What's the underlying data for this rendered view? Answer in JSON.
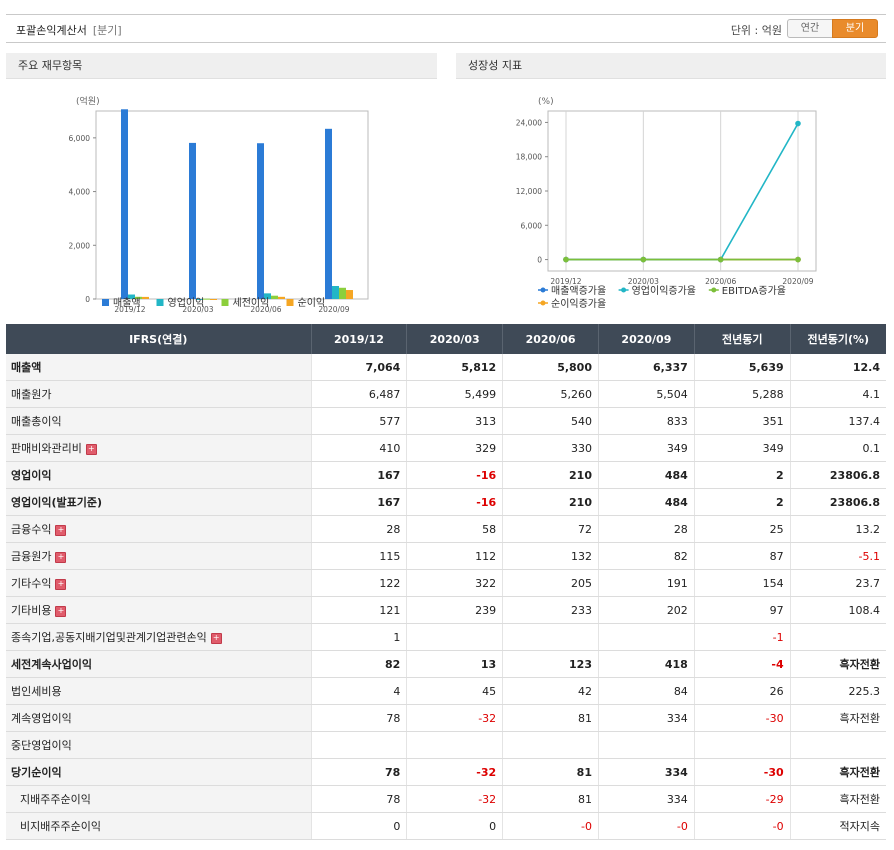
{
  "header": {
    "title": "포괄손익계산서",
    "subtitle": "[분기]",
    "unit_label": "단위 : 억원",
    "toggle_annual": "연간",
    "toggle_quarter": "분기"
  },
  "left_panel": {
    "title": "주요 재무항목"
  },
  "right_panel": {
    "title": "성장성 지표"
  },
  "chart_data": [
    {
      "type": "bar",
      "unit_label": "(억원)",
      "categories": [
        "2019/12",
        "2020/03",
        "2020/06",
        "2020/09"
      ],
      "ylim": [
        0,
        7000
      ],
      "yticks": [
        0,
        2000,
        4000,
        6000
      ],
      "ytick_labels": [
        "0",
        "2,000",
        "4,000",
        "6,000"
      ],
      "series": [
        {
          "name": "매출액",
          "color": "#2b7bd6",
          "values": [
            7064,
            5812,
            5800,
            6337
          ]
        },
        {
          "name": "영업이익",
          "color": "#22b6c6",
          "values": [
            167,
            -16,
            210,
            484
          ]
        },
        {
          "name": "세전이익",
          "color": "#8ccf3c",
          "values": [
            82,
            13,
            123,
            418
          ]
        },
        {
          "name": "순이익",
          "color": "#f5a623",
          "values": [
            78,
            -32,
            81,
            334
          ]
        }
      ],
      "legend": "bottom",
      "grid": false
    },
    {
      "type": "line",
      "unit_label": "(%)",
      "categories": [
        "2019/12",
        "2020/03",
        "2020/06",
        "2020/09"
      ],
      "ylim": [
        -2000,
        26000
      ],
      "yticks": [
        0,
        6000,
        12000,
        18000,
        24000
      ],
      "ytick_labels": [
        "0",
        "6,000",
        "12,000",
        "18,000",
        "24,000"
      ],
      "series": [
        {
          "name": "매출액증가율",
          "color": "#2b7bd6",
          "values": [
            0,
            0,
            0,
            12.4
          ]
        },
        {
          "name": "영업이익증가율",
          "color": "#22b6c6",
          "values": [
            0,
            0,
            0,
            23806.8
          ]
        },
        {
          "name": "EBITDA증가율",
          "color": "#7cbf3a",
          "values": [
            0,
            0,
            0,
            0
          ]
        },
        {
          "name": "순이익증가율",
          "color": "#f5a623",
          "values": [
            0,
            0,
            0,
            0
          ]
        }
      ],
      "legend": "bottom",
      "grid": "vertical"
    }
  ],
  "table": {
    "headers": [
      "IFRS(연결)",
      "2019/12",
      "2020/03",
      "2020/06",
      "2020/09",
      "전년동기",
      "전년동기(%)"
    ],
    "rows": [
      {
        "label": "매출액",
        "bold": true,
        "expand": false,
        "values": [
          "7,064",
          "5,812",
          "5,800",
          "6,337",
          "5,639",
          "12.4"
        ]
      },
      {
        "label": "매출원가",
        "bold": false,
        "expand": false,
        "values": [
          "6,487",
          "5,499",
          "5,260",
          "5,504",
          "5,288",
          "4.1"
        ]
      },
      {
        "label": "매출총이익",
        "bold": false,
        "expand": false,
        "values": [
          "577",
          "313",
          "540",
          "833",
          "351",
          "137.4"
        ]
      },
      {
        "label": "판매비와관리비",
        "bold": false,
        "expand": true,
        "values": [
          "410",
          "329",
          "330",
          "349",
          "349",
          "0.1"
        ]
      },
      {
        "label": "영업이익",
        "bold": true,
        "expand": false,
        "values": [
          "167",
          "-16",
          "210",
          "484",
          "2",
          "23806.8"
        ]
      },
      {
        "label": "영업이익(발표기준)",
        "bold": true,
        "expand": false,
        "values": [
          "167",
          "-16",
          "210",
          "484",
          "2",
          "23806.8"
        ]
      },
      {
        "label": "금융수익",
        "bold": false,
        "expand": true,
        "values": [
          "28",
          "58",
          "72",
          "28",
          "25",
          "13.2"
        ]
      },
      {
        "label": "금융원가",
        "bold": false,
        "expand": true,
        "values": [
          "115",
          "112",
          "132",
          "82",
          "87",
          "-5.1"
        ]
      },
      {
        "label": "기타수익",
        "bold": false,
        "expand": true,
        "values": [
          "122",
          "322",
          "205",
          "191",
          "154",
          "23.7"
        ]
      },
      {
        "label": "기타비용",
        "bold": false,
        "expand": true,
        "values": [
          "121",
          "239",
          "233",
          "202",
          "97",
          "108.4"
        ]
      },
      {
        "label": "종속기업,공동지배기업및관계기업관련손익",
        "bold": false,
        "expand": true,
        "values": [
          "1",
          "",
          "",
          "",
          "-1",
          ""
        ]
      },
      {
        "label": "세전계속사업이익",
        "bold": true,
        "expand": false,
        "values": [
          "82",
          "13",
          "123",
          "418",
          "-4",
          "흑자전환"
        ]
      },
      {
        "label": "법인세비용",
        "bold": false,
        "expand": false,
        "values": [
          "4",
          "45",
          "42",
          "84",
          "26",
          "225.3"
        ]
      },
      {
        "label": "계속영업이익",
        "bold": false,
        "expand": false,
        "values": [
          "78",
          "-32",
          "81",
          "334",
          "-30",
          "흑자전환"
        ]
      },
      {
        "label": "중단영업이익",
        "bold": false,
        "expand": false,
        "values": [
          "",
          "",
          "",
          "",
          "",
          ""
        ]
      },
      {
        "label": "당기순이익",
        "bold": true,
        "expand": false,
        "values": [
          "78",
          "-32",
          "81",
          "334",
          "-30",
          "흑자전환"
        ]
      },
      {
        "label": "지배주주순이익",
        "bold": false,
        "expand": false,
        "indent": true,
        "values": [
          "78",
          "-32",
          "81",
          "334",
          "-29",
          "흑자전환"
        ]
      },
      {
        "label": "비지배주주순이익",
        "bold": false,
        "expand": false,
        "indent": true,
        "values": [
          "0",
          "0",
          "-0",
          "-0",
          "-0",
          "적자지속"
        ]
      }
    ]
  }
}
